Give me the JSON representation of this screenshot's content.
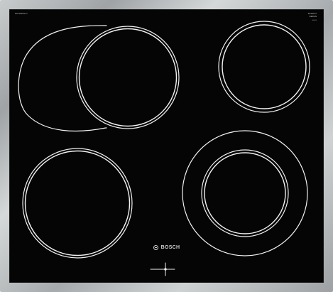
{
  "appliance": {
    "brand": "BOSCH",
    "model_text": "NKN645G17",
    "top_right_label_line1": "SCHOTT",
    "top_right_label_line2": "CERAN",
    "top_right_serial": "000000"
  },
  "icons": {
    "brand_logo": "bosch-logo-icon",
    "control": "crosshair-control-icon"
  },
  "colors": {
    "glass": "#050505",
    "frame": "#b7bbbd",
    "markings": "#f2f2f2"
  }
}
